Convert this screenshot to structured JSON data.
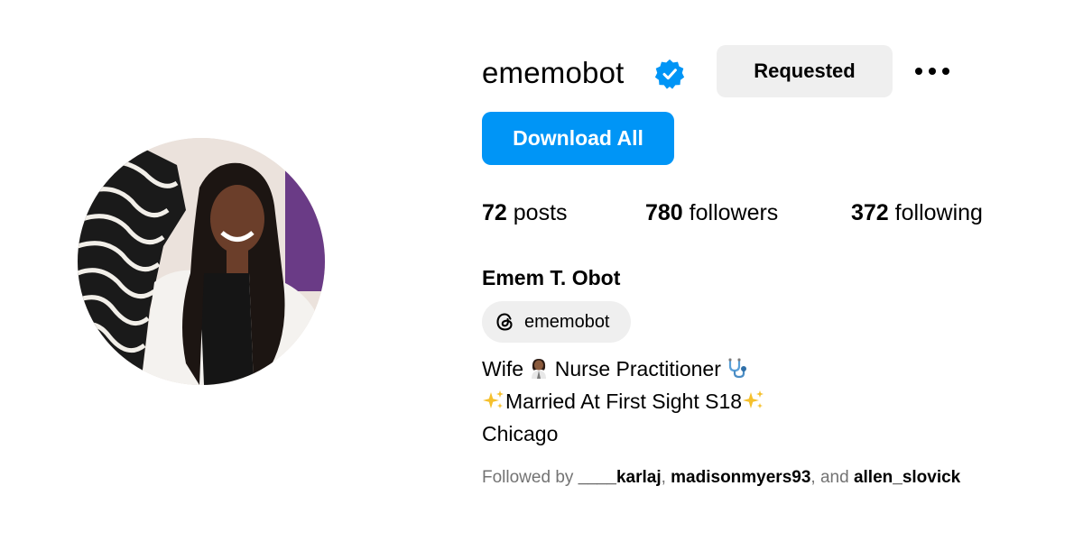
{
  "profile": {
    "username": "ememobot",
    "verified_icon": "verified-badge-icon",
    "requested_label": "Requested",
    "more_icon": "more-options-icon",
    "download_label": "Download All",
    "full_name": "Emem T. Obot",
    "threads_icon": "threads-icon",
    "threads_handle": "ememobot"
  },
  "stats": {
    "posts_count": "72",
    "posts_label": " posts",
    "followers_count": "780",
    "followers_label": " followers",
    "following_count": "372",
    "following_label": " following"
  },
  "bio": {
    "line1_a": "Wife ",
    "line1_emoji1": "woman-health-worker-emoji",
    "line1_b": " Nurse Practitioner ",
    "line1_emoji2": "stethoscope-emoji",
    "line2_emoji1": "sparkles-emoji",
    "line2_text": "Married At First Sight S18",
    "line2_emoji2": "sparkles-emoji",
    "line3": "Chicago"
  },
  "followed_by": {
    "prefix": "Followed by ",
    "user1": "____karlaj",
    "sep1": ", ",
    "user2": "madisonmyers93",
    "sep2": ", and ",
    "user3": "allen_slovick"
  },
  "colors": {
    "primary_button": "#0095f6",
    "secondary_button": "#efefef",
    "verified_badge": "#0095f6",
    "muted_text": "#737373"
  }
}
